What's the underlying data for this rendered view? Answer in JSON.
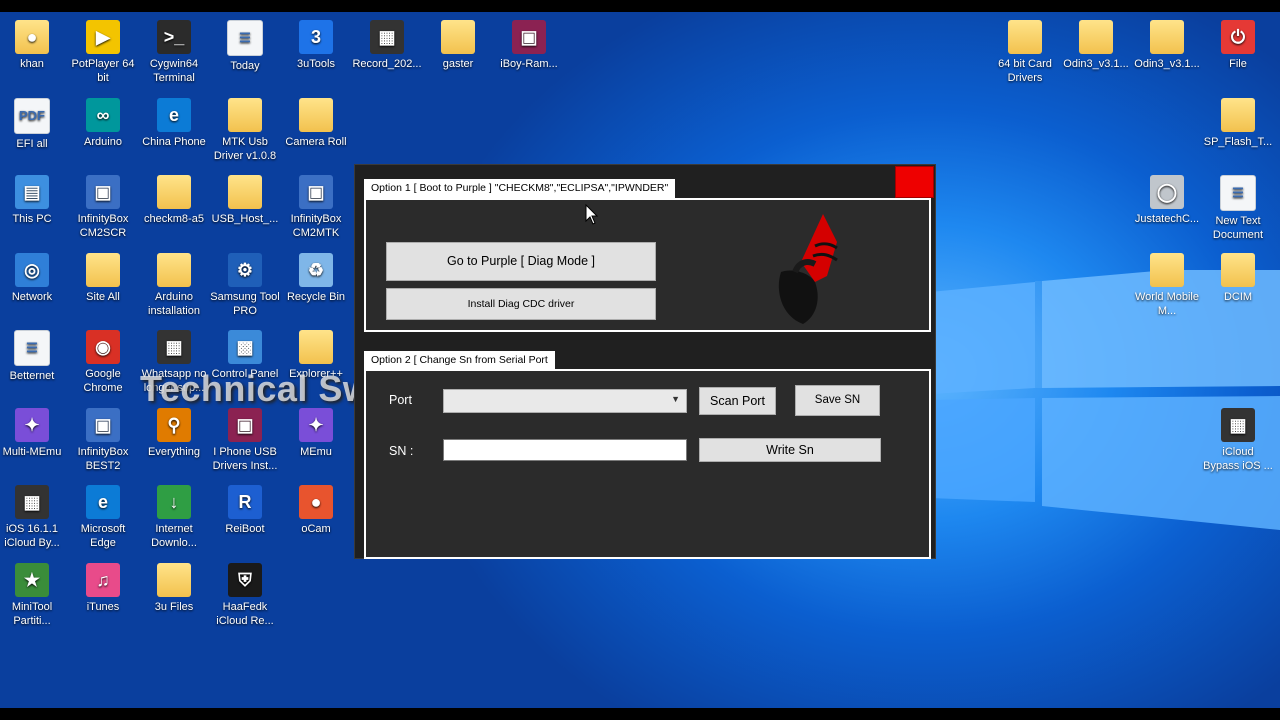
{
  "desktop": {
    "watermark": "Technical Swabi",
    "icons_left": [
      {
        "label": "khan",
        "icon": "user-folder-icon"
      },
      {
        "label": "PotPlayer 64 bit",
        "icon": "potplayer-icon"
      },
      {
        "label": "Cygwin64 Terminal",
        "icon": "terminal-icon"
      },
      {
        "label": "Today",
        "icon": "document-icon"
      },
      {
        "label": "3uTools",
        "icon": "3utools-icon"
      },
      {
        "label": "Record_202...",
        "icon": "video-file-icon"
      },
      {
        "label": "gaster",
        "icon": "folder-icon"
      },
      {
        "label": "iBoy-Ram...",
        "icon": "winrar-icon"
      },
      {
        "label": "EFI all",
        "icon": "pdf-icon"
      },
      {
        "label": "Arduino",
        "icon": "arduino-icon"
      },
      {
        "label": "China Phone",
        "icon": "edge-icon"
      },
      {
        "label": "MTK Usb Driver v1.0.8",
        "icon": "folder-icon"
      },
      {
        "label": "Camera Roll",
        "icon": "folder-icon"
      },
      {
        "label": "This PC",
        "icon": "computer-icon"
      },
      {
        "label": "InfinityBox CM2SCR",
        "icon": "app-icon"
      },
      {
        "label": "checkm8-a5",
        "icon": "folder-icon"
      },
      {
        "label": "USB_Host_...",
        "icon": "folder-icon"
      },
      {
        "label": "InfinityBox CM2MTK",
        "icon": "app-icon"
      },
      {
        "label": "Network",
        "icon": "network-icon"
      },
      {
        "label": "Site All",
        "icon": "folder-icon"
      },
      {
        "label": "Arduino installation",
        "icon": "folder-icon"
      },
      {
        "label": "Samsung Tool PRO",
        "icon": "gear-icon"
      },
      {
        "label": "Recycle Bin",
        "icon": "recycle-bin-icon"
      },
      {
        "label": "Betternet",
        "icon": "document-icon"
      },
      {
        "label": "Google Chrome",
        "icon": "chrome-icon"
      },
      {
        "label": "Whatsapp no longer sup...",
        "icon": "video-file-icon"
      },
      {
        "label": "Control Panel",
        "icon": "control-panel-icon"
      },
      {
        "label": "Explorer++",
        "icon": "folder-icon"
      },
      {
        "label": "Multi-MEmu",
        "icon": "memu-icon"
      },
      {
        "label": "InfinityBox BEST2",
        "icon": "app-icon"
      },
      {
        "label": "Everything",
        "icon": "search-icon"
      },
      {
        "label": "I Phone USB Drivers Inst...",
        "icon": "winrar-icon"
      },
      {
        "label": "MEmu",
        "icon": "memu-icon"
      },
      {
        "label": "iOS 16.1.1 iCloud By...",
        "icon": "video-file-icon"
      },
      {
        "label": "Microsoft Edge",
        "icon": "edge-icon"
      },
      {
        "label": "Internet Downlo...",
        "icon": "download-icon"
      },
      {
        "label": "ReiBoot",
        "icon": "reiboot-icon"
      },
      {
        "label": "oCam",
        "icon": "camera-icon"
      },
      {
        "label": "MiniTool Partiti...",
        "icon": "minitool-icon"
      },
      {
        "label": "iTunes",
        "icon": "music-icon"
      },
      {
        "label": "3u Files",
        "icon": "folder-icon"
      },
      {
        "label": "HaaFedk iCloud Re...",
        "icon": "shield-icon"
      }
    ],
    "icons_right": [
      {
        "label": "64 bit Card Drivers",
        "icon": "folder-icon"
      },
      {
        "label": "Odin3_v3.1...",
        "icon": "folder-icon"
      },
      {
        "label": "Odin3_v3.1...",
        "icon": "folder-icon"
      },
      {
        "label": "File",
        "icon": "power-icon"
      },
      {
        "label": "SP_Flash_T...",
        "icon": "folder-icon"
      },
      {
        "label": "JustatechC...",
        "icon": "disc-icon"
      },
      {
        "label": "New Text Document",
        "icon": "document-icon"
      },
      {
        "label": "World Mobile M...",
        "icon": "folder-icon"
      },
      {
        "label": "DCIM",
        "icon": "folder-icon"
      },
      {
        "label": "iCloud Bypass iOS ...",
        "icon": "video-file-icon"
      }
    ]
  },
  "app": {
    "option1": {
      "tab_label": "Option 1 [ Boot to Purple ] \"CHECKM8\",\"ECLIPSA\",\"IPWNDER\"",
      "diag_button": "Go to Purple [ Diag Mode ]",
      "driver_button": "Install Diag CDC  driver"
    },
    "option2": {
      "tab_label": "Option 2 [ Change Sn from Serial Port",
      "port_label": "Port",
      "port_value": "",
      "scan_button": "Scan Port",
      "save_button": "Save SN",
      "sn_label": "SN :",
      "sn_value": "",
      "write_button": "Write Sn"
    },
    "close_color": "#ee0000"
  }
}
